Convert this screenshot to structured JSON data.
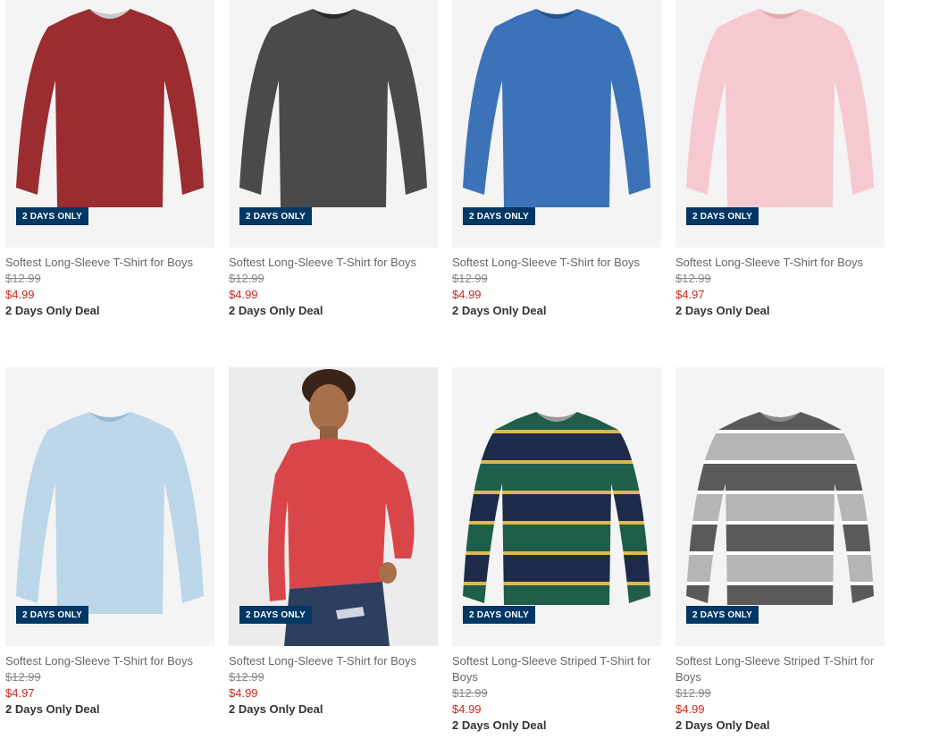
{
  "products": [
    {
      "name": "Softest Long-Sleeve T-Shirt for Boys",
      "original_price": "$12.99",
      "sale_price": "$4.99",
      "deal": "2 Days Only Deal",
      "badge": "2 DAYS ONLY",
      "image": "red-tee"
    },
    {
      "name": "Softest Long-Sleeve T-Shirt for Boys",
      "original_price": "$12.99",
      "sale_price": "$4.99",
      "deal": "2 Days Only Deal",
      "badge": "2 DAYS ONLY",
      "image": "charcoal-tee"
    },
    {
      "name": "Softest Long-Sleeve T-Shirt for Boys",
      "original_price": "$12.99",
      "sale_price": "$4.99",
      "deal": "2 Days Only Deal",
      "badge": "2 DAYS ONLY",
      "image": "blue-tee"
    },
    {
      "name": "Softest Long-Sleeve T-Shirt for Boys",
      "original_price": "$12.99",
      "sale_price": "$4.97",
      "deal": "2 Days Only Deal",
      "badge": "2 DAYS ONLY",
      "image": "pink-tee"
    },
    {
      "name": "Softest Long-Sleeve T-Shirt for Boys",
      "original_price": "$12.99",
      "sale_price": "$4.97",
      "deal": "2 Days Only Deal",
      "badge": "2 DAYS ONLY",
      "image": "light-blue-tee"
    },
    {
      "name": "Softest Long-Sleeve T-Shirt for Boys",
      "original_price": "$12.99",
      "sale_price": "$4.99",
      "deal": "2 Days Only Deal",
      "badge": "2 DAYS ONLY",
      "image": "model-red-tee"
    },
    {
      "name": "Softest Long-Sleeve Striped T-Shirt for Boys",
      "original_price": "$12.99",
      "sale_price": "$4.99",
      "deal": "2 Days Only Deal",
      "badge": "2 DAYS ONLY",
      "image": "green-navy-striped-tee"
    },
    {
      "name": "Softest Long-Sleeve Striped T-Shirt for Boys",
      "original_price": "$12.99",
      "sale_price": "$4.99",
      "deal": "2 Days Only Deal",
      "badge": "2 DAYS ONLY",
      "image": "gray-striped-tee"
    }
  ],
  "colors": {
    "badge_bg": "#003764",
    "sale_price": "#d0271d",
    "red": "#9b2c30",
    "charcoal": "#4a4a4a",
    "blue": "#3c73b8",
    "pink": "#f6c9d0",
    "light_blue": "#bcd6ea",
    "model_red": "#d9464a",
    "green": "#1f5e4a",
    "navy": "#1d2a4a",
    "gold": "#e0b84a",
    "dark_gray": "#5a5a5a",
    "light_gray": "#b5b5b5"
  }
}
